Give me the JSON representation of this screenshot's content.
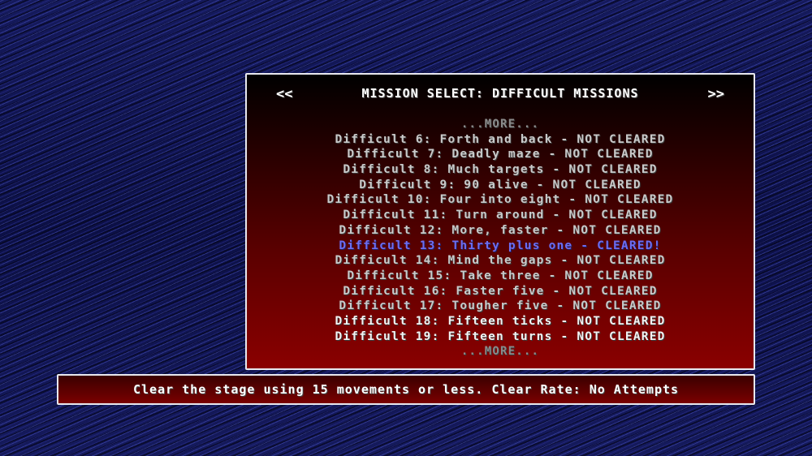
{
  "header": {
    "title": "MISSION SELECT: DIFFICULT MISSIONS",
    "prev_label": "<<",
    "next_label": ">>"
  },
  "missions": {
    "more_top": "...MORE...",
    "items": [
      {
        "label": "Difficult 6: Forth and back - NOT CLEARED"
      },
      {
        "label": "Difficult 7: Deadly maze - NOT CLEARED"
      },
      {
        "label": "Difficult 8: Much targets - NOT CLEARED"
      },
      {
        "label": "Difficult 9: 90 alive - NOT CLEARED"
      },
      {
        "label": "Difficult 10: Four into eight - NOT CLEARED"
      },
      {
        "label": "Difficult 11: Turn around - NOT CLEARED"
      },
      {
        "label": "Difficult 12: More, faster - NOT CLEARED"
      },
      {
        "label": "Difficult 13: Thirty plus one - CLEARED!"
      },
      {
        "label": "Difficult 14: Mind the gaps - NOT CLEARED"
      },
      {
        "label": "Difficult 15: Take three - NOT CLEARED"
      },
      {
        "label": "Difficult 16: Faster five - NOT CLEARED"
      },
      {
        "label": "Difficult 17: Tougher five - NOT CLEARED"
      },
      {
        "label": "Difficult 18: Fifteen ticks - NOT CLEARED"
      },
      {
        "label": "Difficult 19: Fifteen turns - NOT CLEARED"
      }
    ],
    "more_bottom": "...MORE..."
  },
  "description": "Clear the stage using 15 movements or less. Clear Rate: No Attempts",
  "colors": {
    "selected": "#6d6df0",
    "normal": "#c9c9c9",
    "panel_bottom": "#8a0000",
    "background": "#0b0f3a"
  }
}
